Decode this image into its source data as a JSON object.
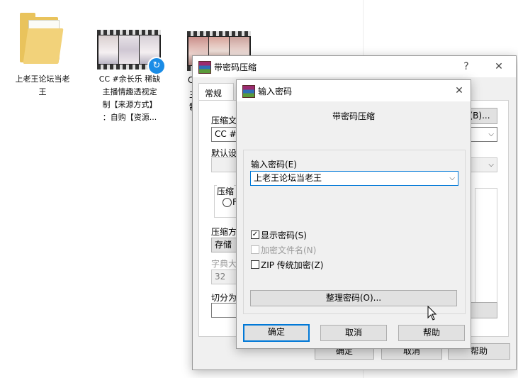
{
  "desktop": {
    "folder_label": "上老王论坛当老王",
    "folder_label_l1": "上老王论坛当老",
    "folder_label_l2": "王",
    "video_label_l1": "CC #余长乐 稀缺",
    "video_label_l2": "主播情趣透视定",
    "video_label_l3": "制【来源方式】",
    "video_label_l4": "：自购【资源...",
    "video2_partial_l1": "C",
    "video2_partial_l2": "主",
    "video2_partial_l3": "制"
  },
  "main_dialog": {
    "title": "带密码压缩",
    "help_symbol": "?",
    "close_symbol": "✕",
    "tab_general": "常规",
    "archive_name_label": "压缩文",
    "browse_button": "(B)...",
    "archive_name_value": "CC #余",
    "default_profile_label": "默认设",
    "compression_group_label": "压缩",
    "radio_partial": "F",
    "method_label": "压缩方",
    "method_value": "存储",
    "dict_label": "字典大",
    "dict_value": "32",
    "split_label": "切分为",
    "ok_button": "确定",
    "cancel_button": "取消",
    "help_button": "帮助"
  },
  "password_dialog": {
    "title": "输入密码",
    "close_symbol": "✕",
    "heading": "带密码压缩",
    "password_label": "输入密码(E)",
    "password_value": "上老王论坛当老王",
    "show_password_label": "显示密码(S)",
    "show_password_checked": true,
    "encrypt_filenames_label": "加密文件名(N)",
    "encrypt_filenames_checked": false,
    "zip_legacy_label": "ZIP 传统加密(Z)",
    "zip_legacy_checked": false,
    "organize_button": "整理密码(O)...",
    "ok_button": "确定",
    "cancel_button": "取消",
    "help_button": "帮助"
  },
  "colors": {
    "accent": "#0078d7",
    "dialog_bg": "#f0f0f0",
    "folder": "#e9c35c"
  }
}
